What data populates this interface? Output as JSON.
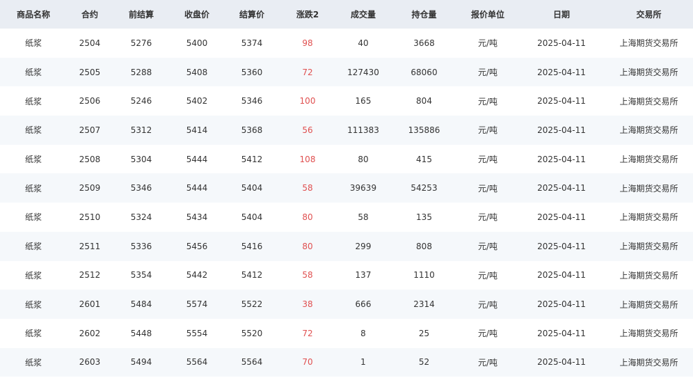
{
  "table": {
    "headers": [
      "商品名称",
      "合约",
      "前结算",
      "收盘价",
      "结算价",
      "涨跌2",
      "成交量",
      "持仓量",
      "报价单位",
      "日期",
      "交易所"
    ],
    "rows": [
      [
        "纸浆",
        "2504",
        "5276",
        "5400",
        "5374",
        "98",
        "40",
        "3668",
        "元/吨",
        "2025-04-11",
        "上海期货交易所"
      ],
      [
        "纸浆",
        "2505",
        "5288",
        "5408",
        "5360",
        "72",
        "127430",
        "68060",
        "元/吨",
        "2025-04-11",
        "上海期货交易所"
      ],
      [
        "纸浆",
        "2506",
        "5246",
        "5402",
        "5346",
        "100",
        "165",
        "804",
        "元/吨",
        "2025-04-11",
        "上海期货交易所"
      ],
      [
        "纸浆",
        "2507",
        "5312",
        "5414",
        "5368",
        "56",
        "111383",
        "135886",
        "元/吨",
        "2025-04-11",
        "上海期货交易所"
      ],
      [
        "纸浆",
        "2508",
        "5304",
        "5444",
        "5412",
        "108",
        "80",
        "415",
        "元/吨",
        "2025-04-11",
        "上海期货交易所"
      ],
      [
        "纸浆",
        "2509",
        "5346",
        "5444",
        "5404",
        "58",
        "39639",
        "54253",
        "元/吨",
        "2025-04-11",
        "上海期货交易所"
      ],
      [
        "纸浆",
        "2510",
        "5324",
        "5434",
        "5404",
        "80",
        "58",
        "135",
        "元/吨",
        "2025-04-11",
        "上海期货交易所"
      ],
      [
        "纸浆",
        "2511",
        "5336",
        "5456",
        "5416",
        "80",
        "299",
        "808",
        "元/吨",
        "2025-04-11",
        "上海期货交易所"
      ],
      [
        "纸浆",
        "2512",
        "5354",
        "5442",
        "5412",
        "58",
        "137",
        "1110",
        "元/吨",
        "2025-04-11",
        "上海期货交易所"
      ],
      [
        "纸浆",
        "2601",
        "5484",
        "5574",
        "5522",
        "38",
        "666",
        "2314",
        "元/吨",
        "2025-04-11",
        "上海期货交易所"
      ],
      [
        "纸浆",
        "2602",
        "5448",
        "5554",
        "5520",
        "72",
        "8",
        "25",
        "元/吨",
        "2025-04-11",
        "上海期货交易所"
      ],
      [
        "纸浆",
        "2603",
        "5494",
        "5564",
        "5564",
        "70",
        "1",
        "52",
        "元/吨",
        "2025-04-11",
        "上海期货交易所"
      ]
    ]
  },
  "colors": {
    "header_bg": "#e9edf3",
    "stripe_bg": "#f5f8fb",
    "change_color": "#e05050",
    "text_color": "#333333"
  }
}
